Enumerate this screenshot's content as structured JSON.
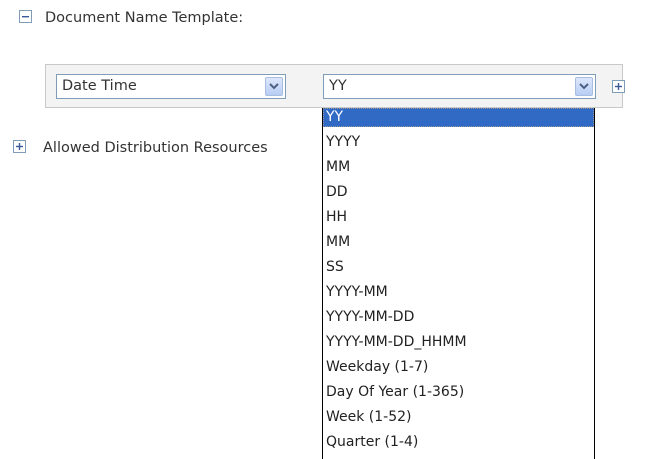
{
  "section_document_name": {
    "toggle_icon": "collapse-minus-icon",
    "label": "Document Name Template:"
  },
  "template_row": {
    "type_select": {
      "value": "Date Time",
      "icon": "chevron-down-icon"
    },
    "format_select": {
      "value": "YY",
      "icon": "chevron-down-icon",
      "options": [
        "YY",
        "YYYY",
        "MM",
        "DD",
        "HH",
        "MM",
        "SS",
        "YYYY-MM",
        "YYYY-MM-DD",
        "YYYY-MM-DD_HHMM",
        "Weekday (1-7)",
        "Day Of Year (1-365)",
        "Week (1-52)",
        "Quarter (1-4)"
      ],
      "highlighted_option": "YY"
    },
    "add_button_icon": "expand-plus-icon"
  },
  "section_allowed_distribution": {
    "toggle_icon": "expand-plus-icon",
    "label": "Allowed Distribution Resources"
  },
  "colors": {
    "highlight": "#316ac5",
    "panel_bg": "#f3f3f3",
    "border": "#7f9db9"
  }
}
